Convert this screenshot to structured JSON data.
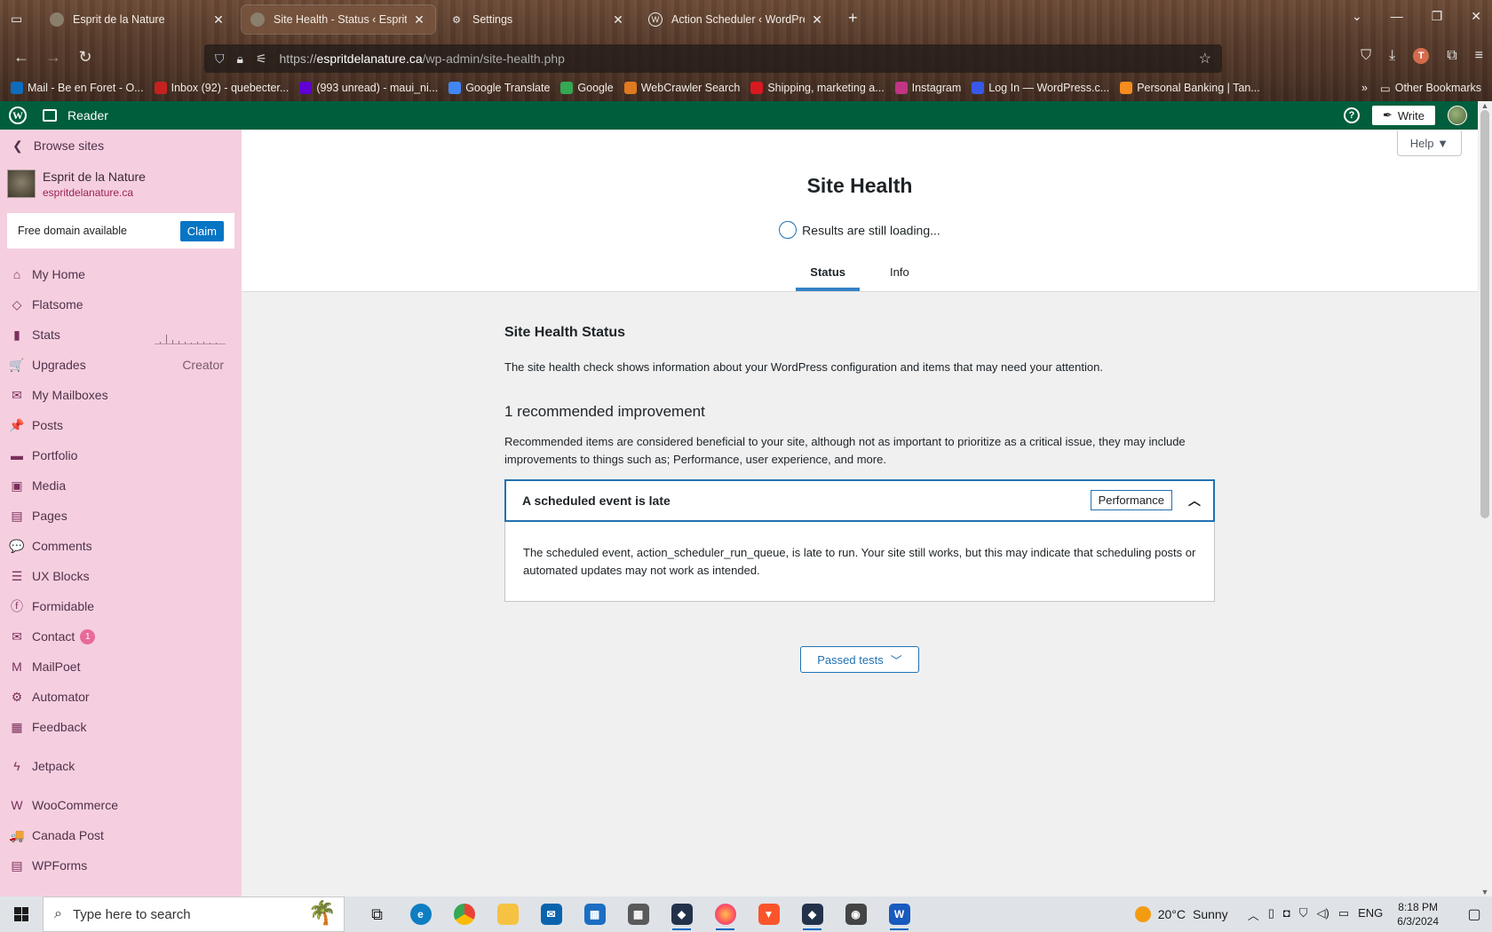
{
  "browser": {
    "tabs": [
      {
        "label": "Esprit de la Nature",
        "active": false
      },
      {
        "label": "Site Health - Status ‹ Esprit de la",
        "active": true
      },
      {
        "label": "Settings",
        "active": false
      },
      {
        "label": "Action Scheduler ‹ WordPress",
        "active": false
      }
    ],
    "url_prefix": "https://",
    "url_host": "espritdelanature.ca",
    "url_path": "/wp-admin/site-health.php",
    "profile_initial": "T",
    "bookmarks": [
      {
        "label": "Mail - Be en Foret - O...",
        "color": "#0f6cbd"
      },
      {
        "label": "Inbox (92) - quebecter...",
        "color": "#c5221f"
      },
      {
        "label": "(993 unread) - maui_ni...",
        "color": "#6001d2"
      },
      {
        "label": "Google Translate",
        "color": "#4285f4"
      },
      {
        "label": "Google",
        "color": "#34a853"
      },
      {
        "label": "WebCrawler Search",
        "color": "#e07a1f"
      },
      {
        "label": "Shipping, marketing a...",
        "color": "#d71920"
      },
      {
        "label": "Instagram",
        "color": "#c13584"
      },
      {
        "label": "Log In — WordPress.c...",
        "color": "#3858e9"
      },
      {
        "label": "Personal Banking | Tan...",
        "color": "#f68b1f"
      }
    ],
    "other_bookmarks": "Other Bookmarks"
  },
  "wpbar": {
    "reader": "Reader",
    "write": "Write"
  },
  "sidebar": {
    "browse": "Browse sites",
    "site_name": "Esprit de la Nature",
    "site_url": "espritdelanature.ca",
    "free_domain": "Free domain available",
    "claim": "Claim",
    "items": [
      {
        "label": "My Home",
        "icon": "home-icon",
        "glyph": "⌂"
      },
      {
        "label": "Flatsome",
        "icon": "flatsome-icon",
        "glyph": "◇"
      },
      {
        "label": "Stats",
        "icon": "stats-icon",
        "glyph": "▮"
      },
      {
        "label": "Upgrades",
        "icon": "cart-icon",
        "glyph": "🛒",
        "right": "Creator"
      },
      {
        "label": "My Mailboxes",
        "icon": "mail-icon",
        "glyph": "✉"
      },
      {
        "label": "Posts",
        "icon": "pin-icon",
        "glyph": "📌"
      },
      {
        "label": "Portfolio",
        "icon": "folder-icon",
        "glyph": "▬"
      },
      {
        "label": "Media",
        "icon": "media-icon",
        "glyph": "▣"
      },
      {
        "label": "Pages",
        "icon": "pages-icon",
        "glyph": "▤"
      },
      {
        "label": "Comments",
        "icon": "comment-icon",
        "glyph": "💬"
      },
      {
        "label": "UX Blocks",
        "icon": "blocks-icon",
        "glyph": "☰"
      },
      {
        "label": "Formidable",
        "icon": "formidable-icon",
        "glyph": "ⓕ"
      },
      {
        "label": "Contact",
        "icon": "mail-icon",
        "glyph": "✉",
        "badge": "1"
      },
      {
        "label": "MailPoet",
        "icon": "mailpoet-icon",
        "glyph": "M"
      },
      {
        "label": "Automator",
        "icon": "automator-icon",
        "glyph": "⚙"
      },
      {
        "label": "Feedback",
        "icon": "feedback-icon",
        "glyph": "▦"
      }
    ],
    "items2": [
      {
        "label": "Jetpack",
        "icon": "jetpack-icon",
        "glyph": "ϟ"
      }
    ],
    "items3": [
      {
        "label": "WooCommerce",
        "icon": "woocommerce-icon",
        "glyph": "W"
      },
      {
        "label": "Canada Post",
        "icon": "truck-icon",
        "glyph": "🚚"
      },
      {
        "label": "WPForms",
        "icon": "wpforms-icon",
        "glyph": "▤"
      }
    ]
  },
  "main": {
    "help": "Help ▼",
    "title": "Site Health",
    "loading": "Results are still loading...",
    "tabs": [
      "Status",
      "Info"
    ],
    "status_heading": "Site Health Status",
    "status_desc": "The site health check shows information about your WordPress configuration and items that may need your attention.",
    "improvement_heading": "1 recommended improvement",
    "improvement_desc": "Recommended items are considered beneficial to your site, although not as important to prioritize as a critical issue, they may include improvements to things such as; Performance, user experience, and more.",
    "issue_title": "A scheduled event is late",
    "issue_badge": "Performance",
    "issue_body": "The scheduled event, action_scheduler_run_queue, is late to run. Your site still works, but this may indicate that scheduling posts or automated updates may not work as intended.",
    "passed": "Passed tests"
  },
  "taskbar": {
    "search_placeholder": "Type here to search",
    "weather_temp": "20°C",
    "weather_cond": "Sunny",
    "lang": "ENG",
    "time": "8:18 PM",
    "date": "6/3/2024"
  }
}
